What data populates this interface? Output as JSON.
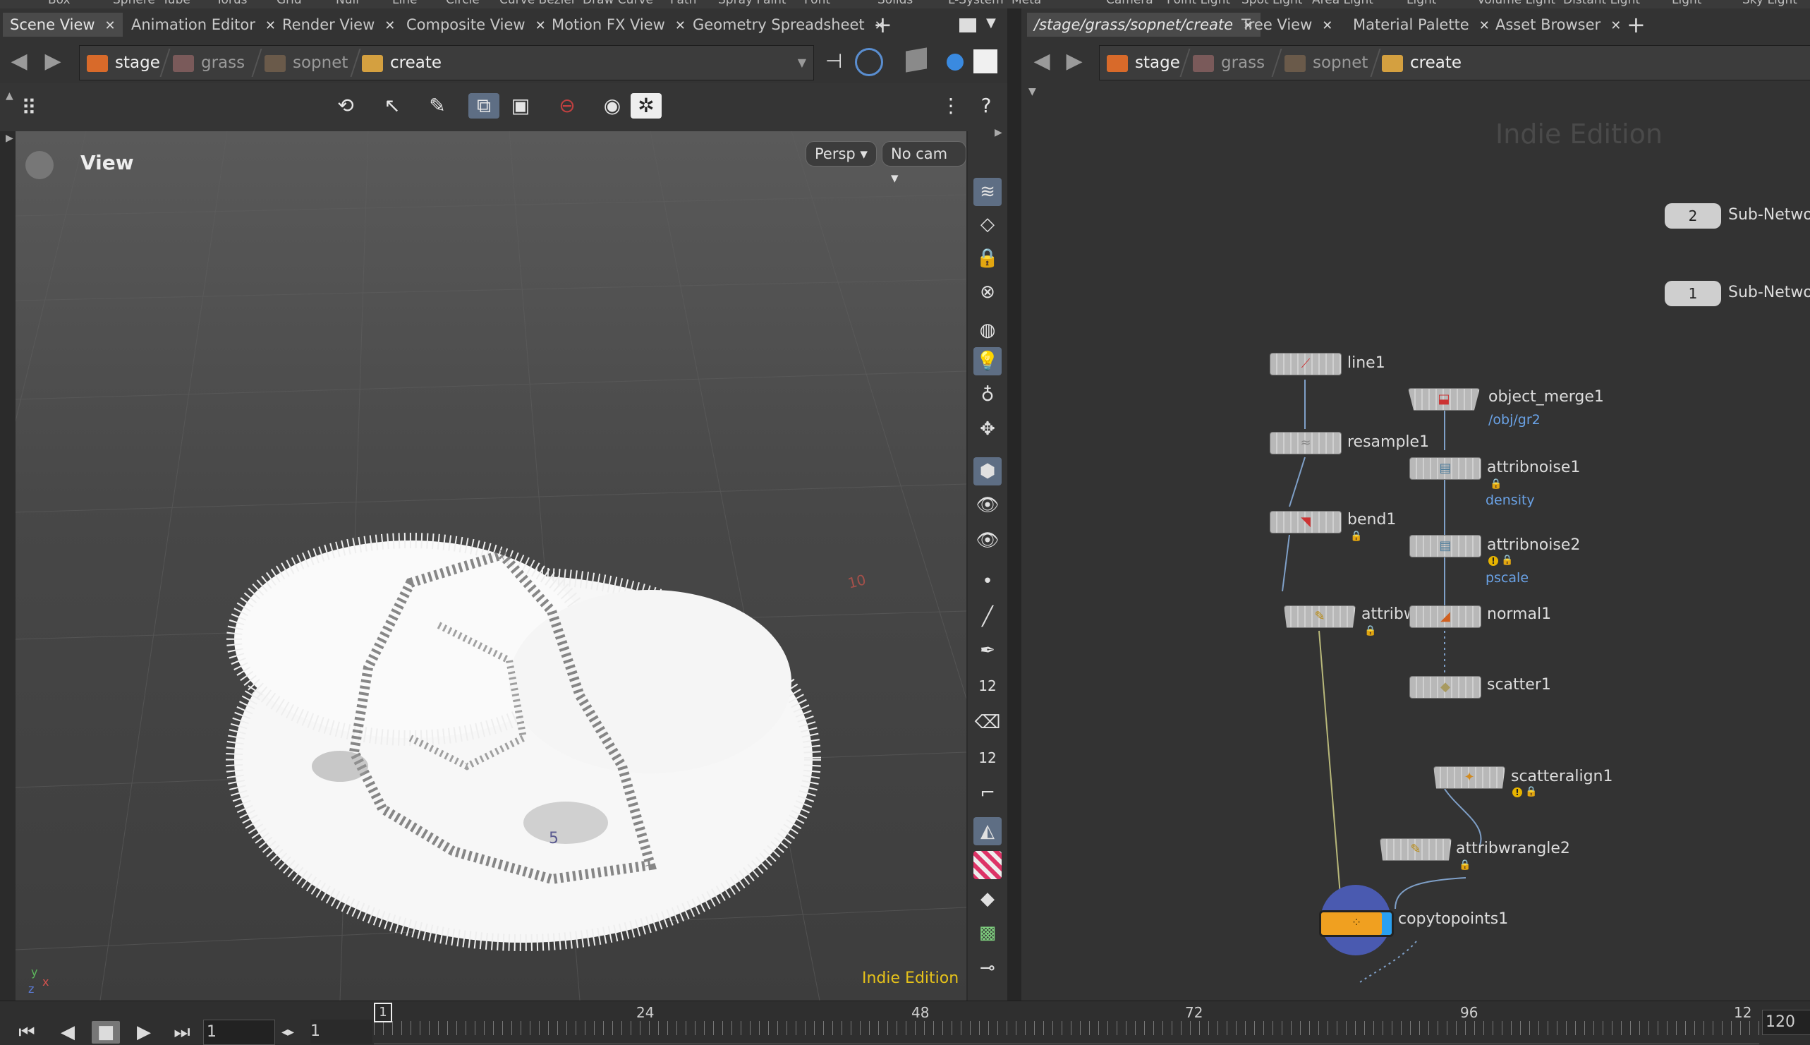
{
  "shelf": [
    "Box",
    "Sphere",
    "Tube",
    "Torus",
    "Grid",
    "Null",
    "Line",
    "Circle",
    "Curve Bezier",
    "Draw Curve",
    "Path",
    "Spray Paint",
    "Font",
    "Solids",
    "L-System",
    "Meta",
    "Camera",
    "Point Light",
    "Spot Light",
    "Area Light",
    "Light",
    "Volume Light",
    "Distant Light",
    "Light",
    "Sky Light"
  ],
  "left_tabs": [
    {
      "label": "Scene View",
      "active": true
    },
    {
      "label": "Animation Editor"
    },
    {
      "label": "Render View"
    },
    {
      "label": "Composite View"
    },
    {
      "label": "Motion FX View"
    },
    {
      "label": "Geometry Spreadsheet"
    }
  ],
  "right_tabs": [
    {
      "label": "/stage/grass/sopnet/create",
      "active": true
    },
    {
      "label": "Tree View"
    },
    {
      "label": "Material Palette"
    },
    {
      "label": "Asset Browser"
    }
  ],
  "path": [
    "stage",
    "grass",
    "sopnet",
    "create"
  ],
  "viewer": {
    "title": "View",
    "persp": "Persp ▾",
    "cam": "No cam ▾",
    "edition": "Indie Edition",
    "grid_labels": [
      "10",
      "5"
    ],
    "axes": {
      "y": "y",
      "x": "x",
      "z": "z"
    }
  },
  "network": {
    "watermark": "Indie Edition",
    "subnets": [
      {
        "num": "2",
        "label": "Sub-Networ"
      },
      {
        "num": "1",
        "label": "Sub-Networ"
      }
    ],
    "nodes": {
      "line1": "line1",
      "object_merge1": "object_merge1",
      "object_merge1_sub": "/obj/gr2",
      "resample1": "resample1",
      "attribnoise1": "attribnoise1",
      "attribnoise1_sub": "density",
      "bend1": "bend1",
      "attribnoise2": "attribnoise2",
      "attribnoise2_sub": "pscale",
      "attribw": "attribw",
      "normal1": "normal1",
      "scatter1": "scatter1",
      "scatteralign1": "scatteralign1",
      "attribwrangle2": "attribwrangle2",
      "copytopoints1": "copytopoints1"
    }
  },
  "timeline": {
    "current_frame": "1",
    "start": "1",
    "marker": "1",
    "ticks": [
      "24",
      "48",
      "72",
      "96",
      "12"
    ],
    "end": "120"
  },
  "colors": {
    "accent": "#5e6e84",
    "warning": "#e7b400",
    "link": "#6aa2e6",
    "copytopoints": "#f0a020"
  }
}
